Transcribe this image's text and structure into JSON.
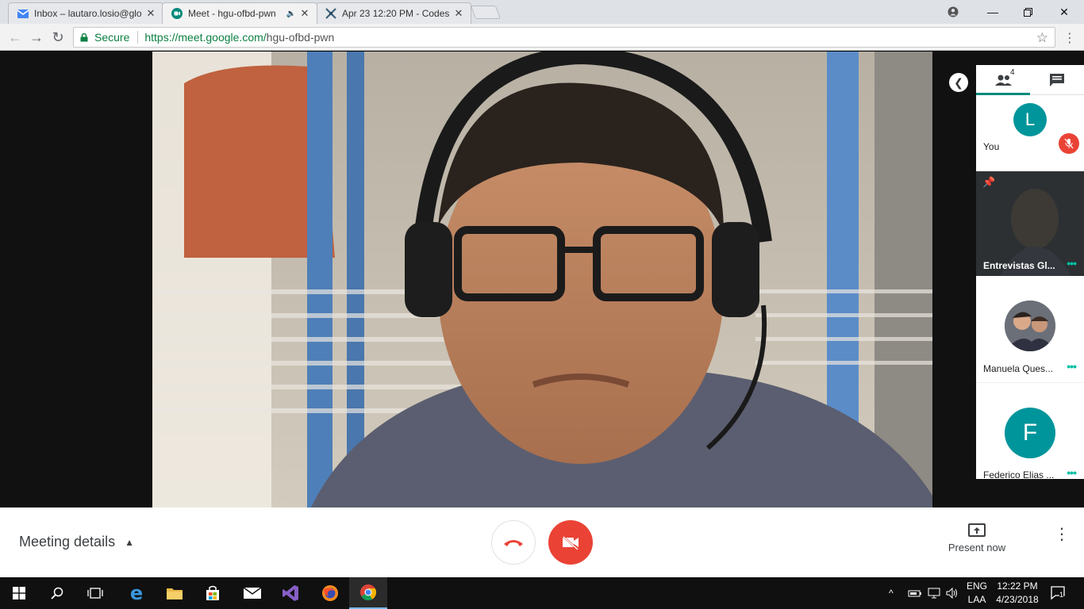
{
  "browser": {
    "tabs": [
      {
        "title": "Inbox – lautaro.losio@glo",
        "icon": "inbox-icon"
      },
      {
        "title": "Meet - hgu-ofbd-pwn",
        "icon": "meet-icon",
        "active": true
      },
      {
        "title": "Apr 23 12:20 PM - Codes",
        "icon": "coderpad-icon"
      }
    ],
    "secure_label": "Secure",
    "url_host": "https://meet.google.com/",
    "url_path": "hgu-ofbd-pwn"
  },
  "sidebar": {
    "participant_count": "4",
    "participants": [
      {
        "name": "You",
        "avatar_letter": "L",
        "muted": true
      },
      {
        "name": "Entrevistas Gl...",
        "pinned": true
      },
      {
        "name": "Manuela Ques..."
      },
      {
        "name": "Federico Elias ...",
        "avatar_letter": "F"
      }
    ]
  },
  "controls": {
    "meeting_details": "Meeting details",
    "present_now": "Present now"
  },
  "taskbar": {
    "language_top": "ENG",
    "language_bottom": "LAA",
    "time": "12:22 PM",
    "date": "4/23/2018",
    "notification_count": "1"
  },
  "colors": {
    "accent": "#00897b",
    "danger": "#ea4335",
    "avatar": "#00959b"
  }
}
